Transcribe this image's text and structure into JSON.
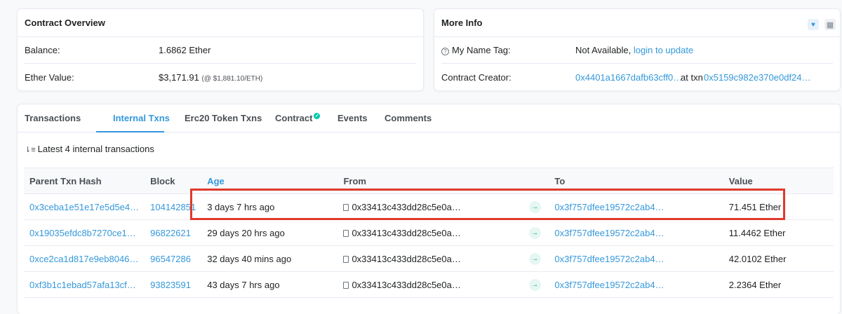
{
  "overview": {
    "title": "Contract Overview",
    "balance_label": "Balance:",
    "balance_value": "1.6862 Ether",
    "ether_value_label": "Ether Value:",
    "ether_value": "$3,171.91",
    "ether_price": "(@ $1,881.10/ETH)"
  },
  "more_info": {
    "title": "More Info",
    "name_tag_label": "My Name Tag:",
    "name_tag_value": "Not Available,",
    "name_tag_link": "login to update",
    "creator_label": "Contract Creator:",
    "creator_address": "0x4401a1667dafb63cff0…",
    "at_txn": "at txn",
    "creator_txn": "0x5159c982e370e0df24…"
  },
  "tabs": [
    "Transactions",
    "Internal Txns",
    "Erc20 Token Txns",
    "Contract",
    "Events",
    "Comments"
  ],
  "summary": "Latest 4 internal transactions",
  "table": {
    "headers": [
      "Parent Txn Hash",
      "Block",
      "Age",
      "From",
      "",
      "To",
      "Value"
    ],
    "rows": [
      {
        "hash": "0x3ceba1e51e17e5d5e4…",
        "block": "104142851",
        "age": "3 days 7 hrs ago",
        "from": "0x33413c433dd28c5e0a…",
        "to": "0x3f757dfee19572c2ab4…",
        "value": "71.451 Ether"
      },
      {
        "hash": "0x19035efdc8b7270ce1…",
        "block": "96822621",
        "age": "29 days 20 hrs ago",
        "from": "0x33413c433dd28c5e0a…",
        "to": "0x3f757dfee19572c2ab4…",
        "value": "11.4462 Ether"
      },
      {
        "hash": "0xce2ca1d817e9eb8046…",
        "block": "96547286",
        "age": "32 days 40 mins ago",
        "from": "0x33413c433dd28c5e0a…",
        "to": "0x3f757dfee19572c2ab4…",
        "value": "42.0102 Ether"
      },
      {
        "hash": "0xf3b1c1ebad57afa13cf…",
        "block": "93823591",
        "age": "43 days 7 hrs ago",
        "from": "0x33413c433dd28c5e0a…",
        "to": "0x3f757dfee19572c2ab4…",
        "value": "2.2364 Ether"
      }
    ]
  },
  "colors": {
    "accent": "#3498db",
    "highlight": "#e0392c",
    "success": "#00c9a7"
  }
}
